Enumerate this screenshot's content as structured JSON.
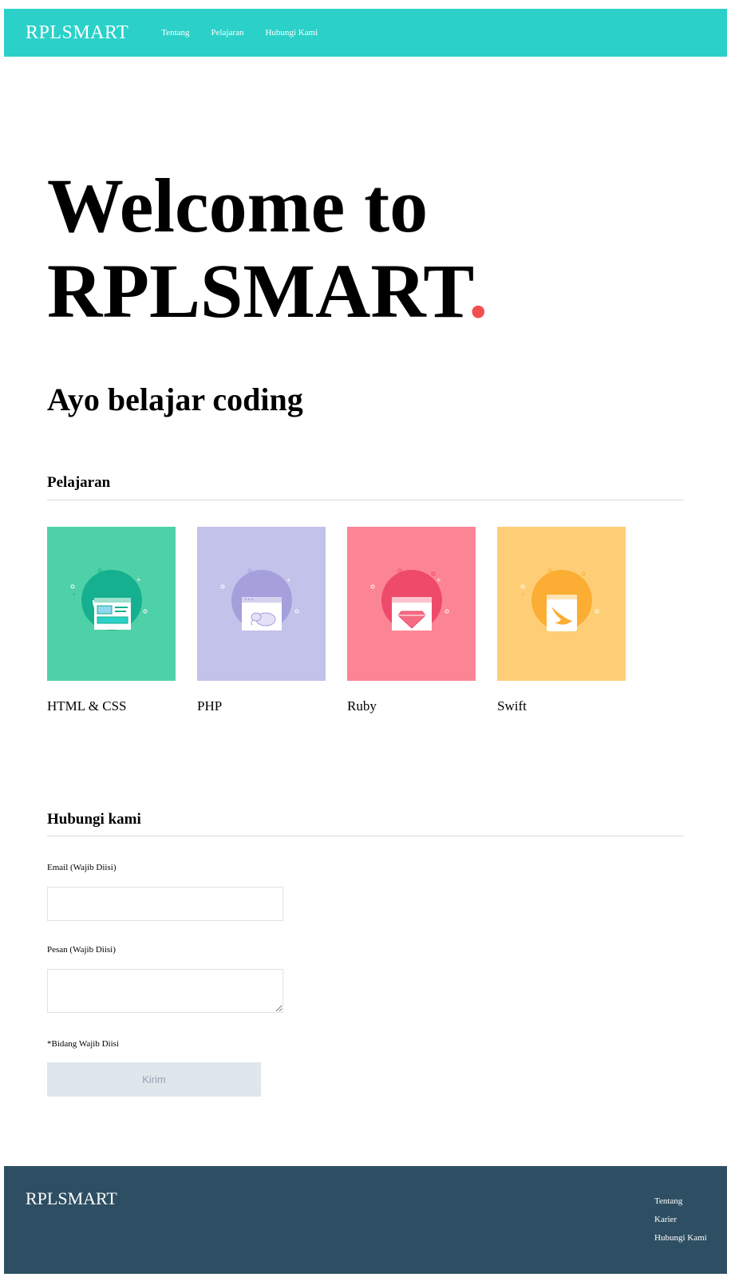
{
  "header": {
    "logo": "RPLSMART",
    "nav": [
      "Tentang",
      "Pelajaran",
      "Hubungi Kami"
    ],
    "bg_color": "#2bd1c9"
  },
  "hero": {
    "line1": "Welcome to",
    "line2": "RPLSMART",
    "dot": ".",
    "dot_color": "#f24e4e"
  },
  "subtitle": "Ayo belajar coding",
  "lessons": {
    "title": "Pelajaran",
    "items": [
      {
        "label": "HTML & CSS",
        "bg": "#4fd1a8",
        "circle": "#14b08f",
        "icon": "html-css-icon"
      },
      {
        "label": "PHP",
        "bg": "#c2c2ea",
        "circle": "#a59fdc",
        "icon": "php-elephant-icon"
      },
      {
        "label": "Ruby",
        "bg": "#fc8595",
        "circle": "#ee4a6a",
        "icon": "ruby-gem-icon"
      },
      {
        "label": "Swift",
        "bg": "#fece77",
        "circle": "#fbae33",
        "icon": "swift-bird-icon"
      }
    ]
  },
  "contact": {
    "title": "Hubungi kami",
    "email_label": "Email (Wajib Diisi)",
    "message_label": "Pesan (Wajib Diisi)",
    "required_note": "*Bidang Wajib Diisi",
    "submit_label": "Kirim"
  },
  "footer": {
    "logo": "RPLSMART",
    "links": [
      "Tentang",
      "Karier",
      "Hubungi Kami"
    ],
    "bg_color": "#2e4f63"
  }
}
